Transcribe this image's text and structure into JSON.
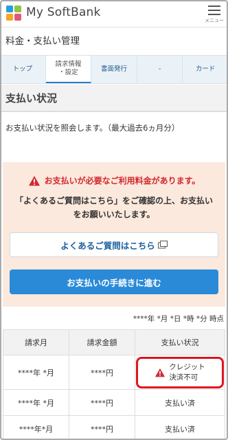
{
  "header": {
    "brand": "My SoftBank",
    "menu_label": "メニュー"
  },
  "section_title": "料金・支払い管理",
  "tabs": [
    {
      "label_line1": "トップ",
      "label_line2": ""
    },
    {
      "label_line1": "請求情報",
      "label_line2": "・設定"
    },
    {
      "label_line1": "書面発行",
      "label_line2": ""
    },
    {
      "label_line1": "-",
      "label_line2": ""
    },
    {
      "label_line1": "カード",
      "label_line2": ""
    }
  ],
  "page_heading": "支払い状況",
  "intro": "お支払い状況を照会します。（最大過去6ヵ月分）",
  "notice": {
    "title": "お支払いが必要なご利用料金があります。",
    "body": "「よくあるご質問はこちら」をご確認の上、お支払いをお願いいたします。",
    "faq_button": "よくあるご質問はこちら",
    "pay_button": "お支払いの手続きに進む"
  },
  "timestamp": "****年 *月 *日 *時 *分 時点",
  "table": {
    "headers": [
      "請求月",
      "請求金額",
      "支払い状況"
    ],
    "rows": [
      {
        "month": "****年 *月",
        "amount": "****円",
        "status_line1": "クレジット",
        "status_line2": "決済不可"
      },
      {
        "month": "****年 *月",
        "amount": "****円",
        "status_line1": "支払い済",
        "status_line2": ""
      },
      {
        "month": "****年*月",
        "amount": "****円",
        "status_line1": "支払い済",
        "status_line2": ""
      }
    ]
  },
  "colors": {
    "accent_blue": "#2a8ad8",
    "warning_red": "#d1282e",
    "notice_bg": "#fce9dd"
  },
  "icons": [
    "logo-icon",
    "menu-icon",
    "warning-icon",
    "external-link-icon"
  ]
}
